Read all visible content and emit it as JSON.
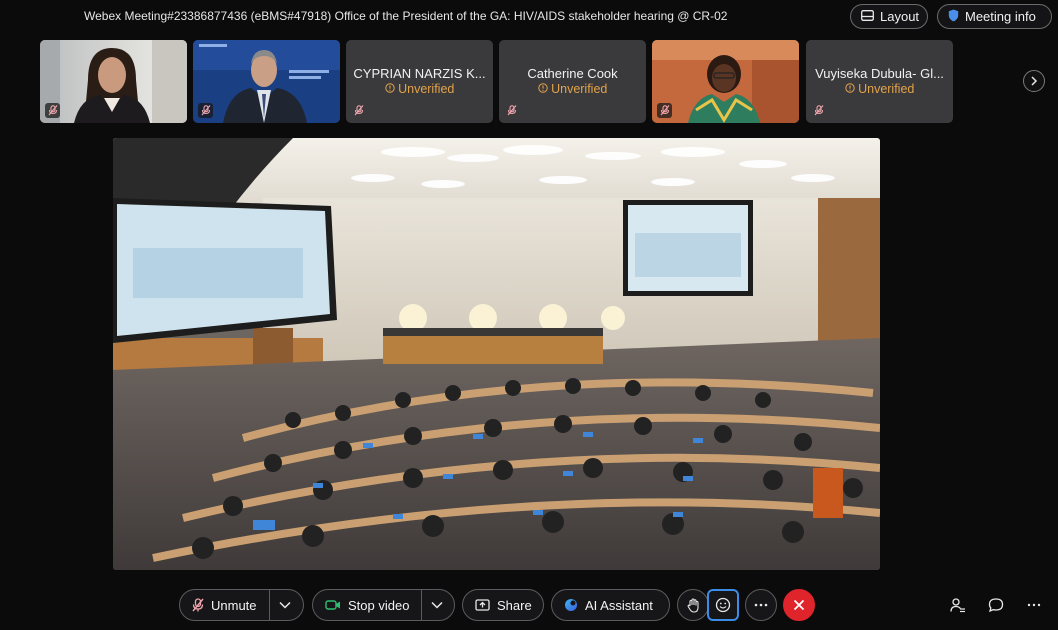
{
  "window": {
    "title": "Webex Meeting#23386877436 (eBMS#47918) Office of the President of the GA: HIV/AIDS stakeholder hearing @ CR-02"
  },
  "header": {
    "layout_label": "Layout",
    "meeting_info_label": "Meeting info"
  },
  "participants": [
    {
      "name": "",
      "status": "",
      "type": "video",
      "muted": true
    },
    {
      "name": "",
      "status": "",
      "type": "video",
      "muted": true
    },
    {
      "name": "CYPRIAN NARZIS K...",
      "status": "Unverified",
      "type": "name",
      "muted": true
    },
    {
      "name": "Catherine Cook",
      "status": "Unverified",
      "type": "name",
      "muted": true
    },
    {
      "name": "",
      "status": "",
      "type": "video",
      "muted": true
    },
    {
      "name": "Vuyiseka Dubula- Gl...",
      "status": "Unverified",
      "type": "name",
      "muted": true
    }
  ],
  "controls": {
    "unmute_label": "Unmute",
    "stop_video_label": "Stop video",
    "share_label": "Share",
    "ai_assistant_label": "AI Assistant"
  },
  "colors": {
    "background": "#0b0b0c",
    "unverified": "#e2a24a",
    "mute_icon": "#f0a5ad",
    "end_call": "#e0242c",
    "focus_ring": "#3b8de8",
    "video_icon": "#2fbf71"
  }
}
